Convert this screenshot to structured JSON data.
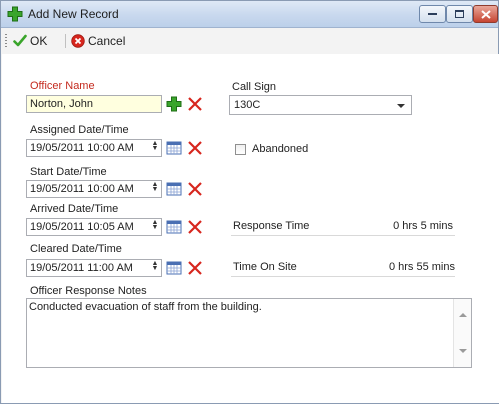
{
  "window": {
    "title": "Add New Record",
    "icons": {
      "app": "green-plus-icon",
      "minimize": "minimize-icon",
      "maximize": "maximize-icon",
      "close": "close-icon"
    }
  },
  "toolbar": {
    "ok_label": "OK",
    "cancel_label": "Cancel",
    "icons": {
      "ok": "green-check-icon",
      "cancel": "red-cancel-icon"
    }
  },
  "form": {
    "officer_name": {
      "label": "Officer Name",
      "value": "Norton, John"
    },
    "call_sign": {
      "label": "Call Sign",
      "value": "130C"
    },
    "assigned": {
      "label": "Assigned Date/Time",
      "value": "19/05/2011 10:00 AM"
    },
    "abandoned": {
      "label": "Abandoned",
      "checked": false
    },
    "start": {
      "label": "Start Date/Time",
      "value": "19/05/2011 10:00 AM"
    },
    "arrived": {
      "label": "Arrived Date/Time",
      "value": "19/05/2011 10:05 AM"
    },
    "response_time": {
      "label": "Response Time",
      "value": "0 hrs 5 mins"
    },
    "cleared": {
      "label": "Cleared Date/Time",
      "value": "19/05/2011 11:00 AM"
    },
    "time_on_site": {
      "label": "Time On Site",
      "value": "0 hrs 55 mins"
    },
    "notes": {
      "label": "Officer Response Notes",
      "value": "Conducted evacuation of staff from the building."
    }
  },
  "colors": {
    "required_label": "#c42a1e",
    "accent_green": "#3aa52b",
    "clear_red": "#d7261e"
  }
}
